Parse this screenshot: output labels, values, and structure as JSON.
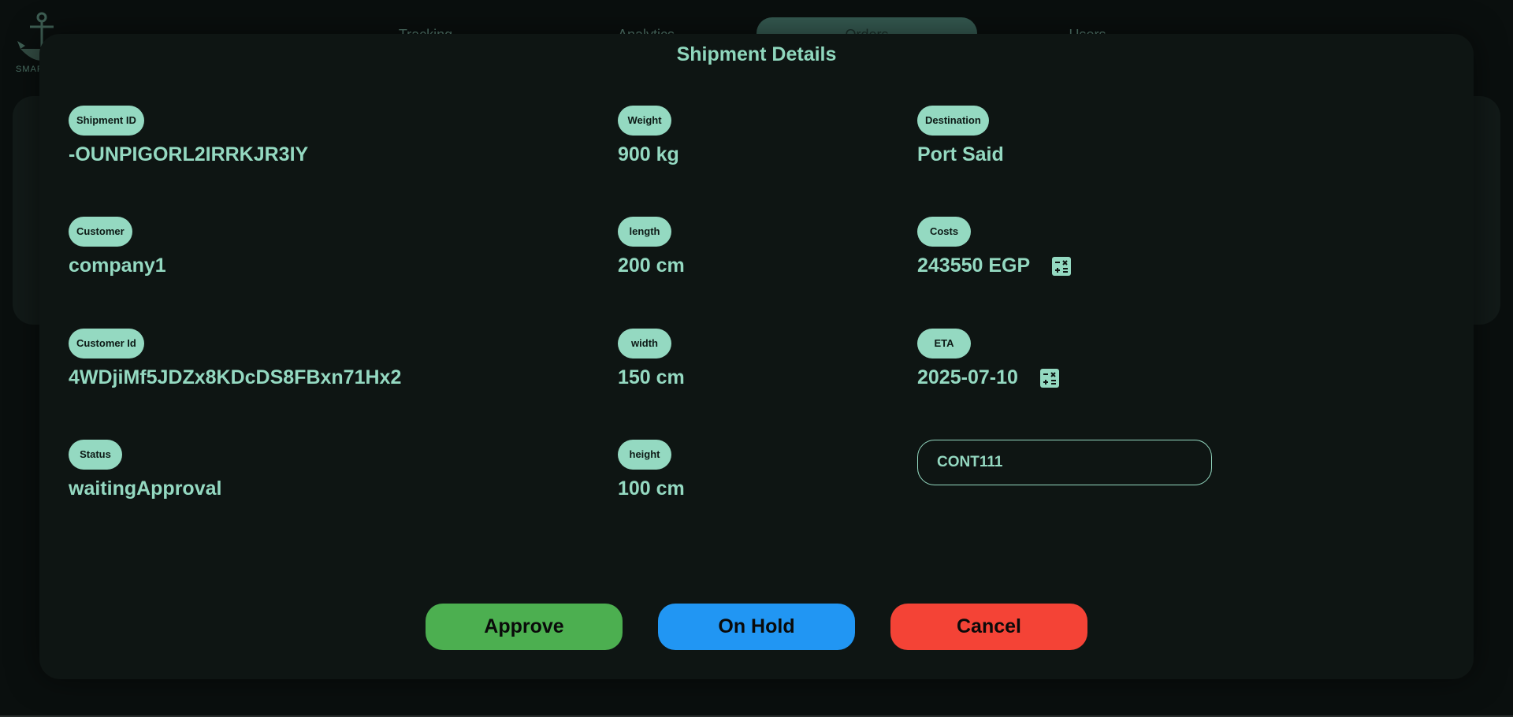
{
  "nav": {
    "tabs": [
      {
        "label": "Tracking"
      },
      {
        "label": "Analytics"
      },
      {
        "label": "Orders"
      },
      {
        "label": "Users"
      }
    ]
  },
  "brand": {
    "text": "SMAR"
  },
  "modal": {
    "title": "Shipment Details",
    "fields": {
      "shipment_id": {
        "label": "Shipment ID",
        "value": "-OUNPIGORL2IRRKJR3IY"
      },
      "customer": {
        "label": "Customer",
        "value": "company1"
      },
      "customer_id": {
        "label": "Customer Id",
        "value": "4WDjiMf5JDZx8KDcDS8FBxn71Hx2"
      },
      "status": {
        "label": "Status",
        "value": "waitingApproval"
      },
      "weight": {
        "label": "Weight",
        "value": "900 kg"
      },
      "length": {
        "label": "length",
        "value": "200 cm"
      },
      "width": {
        "label": "width",
        "value": "150 cm"
      },
      "height": {
        "label": "height",
        "value": "100 cm"
      },
      "destination": {
        "label": "Destination",
        "value": "Port Said"
      },
      "costs": {
        "label": "Costs",
        "value": "243550 EGP",
        "icon": "calculator-icon"
      },
      "eta": {
        "label": "ETA",
        "value": "2025-07-10",
        "icon": "calculator-icon"
      }
    },
    "container_input": {
      "value": "CONT111"
    },
    "buttons": {
      "approve": {
        "label": "Approve",
        "color": "#4caf50"
      },
      "on_hold": {
        "label": "On Hold",
        "color": "#2196f3"
      },
      "cancel": {
        "label": "Cancel",
        "color": "#f44336"
      }
    }
  }
}
